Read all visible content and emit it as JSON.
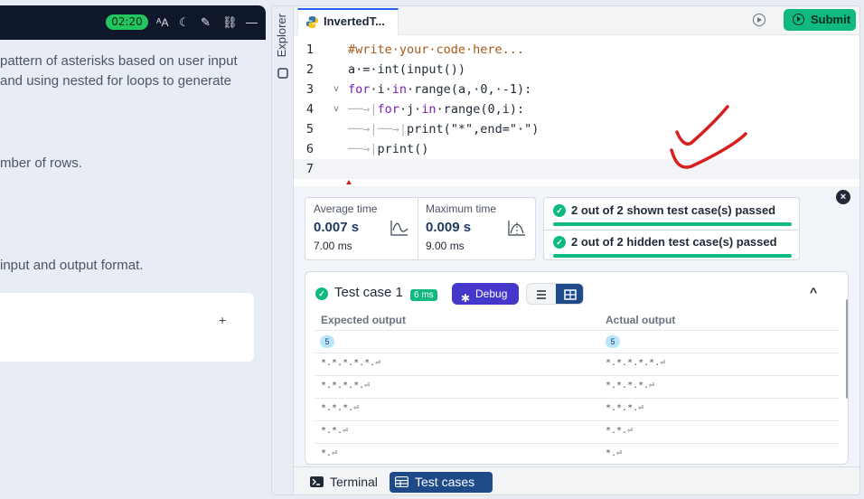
{
  "left_panel": {
    "timer": "02:20",
    "toolbar_icons": [
      "font-size-icon",
      "moon-icon",
      "edit-icon",
      "link-icon",
      "minimize-icon"
    ],
    "lines": [
      "pattern of asterisks based on user input",
      "and using nested for loops to generate",
      "mber of rows.",
      "input and output format."
    ],
    "card_plus": "+"
  },
  "explorer": {
    "label": "Explorer"
  },
  "editor": {
    "file_tab": "InvertedT...",
    "submit_label": "Submit",
    "line_numbers": [
      "1",
      "2",
      "3",
      "4",
      "5",
      "6",
      "7"
    ],
    "annotation": "hand-drawn-double-check-mark"
  },
  "results": {
    "close": "×",
    "average": {
      "label": "Average time",
      "value": "0.007 s",
      "sub": "7.00 ms"
    },
    "maximum": {
      "label": "Maximum time",
      "value": "0.009 s",
      "sub": "9.00 ms"
    },
    "shown_passed": "2 out of 2 shown test case(s) passed",
    "hidden_passed": "2 out of 2 hidden test case(s) passed",
    "test_case": {
      "title": "Test case 1",
      "time": "6 ms",
      "debug_label": "Debug",
      "expected_header": "Expected output",
      "actual_header": "Actual output",
      "input_badge": "5",
      "expected_rows": [
        "*.*.*.*.*.⏎",
        "*.*.*.*.⏎",
        "*.*.*.⏎",
        "*.*.⏎",
        "*.⏎"
      ],
      "actual_rows": [
        "*.*.*.*.*.⏎",
        "*.*.*.*.⏎",
        "*.*.*.⏎",
        "*.*.⏎",
        "*.⏎"
      ]
    }
  },
  "bottom_tabs": {
    "terminal": "Terminal",
    "test_cases": "Test cases"
  },
  "colors": {
    "accent": "#10b981",
    "primary": "#1e4a8a",
    "debug": "#4338ca",
    "annotation": "#d61f1f"
  }
}
